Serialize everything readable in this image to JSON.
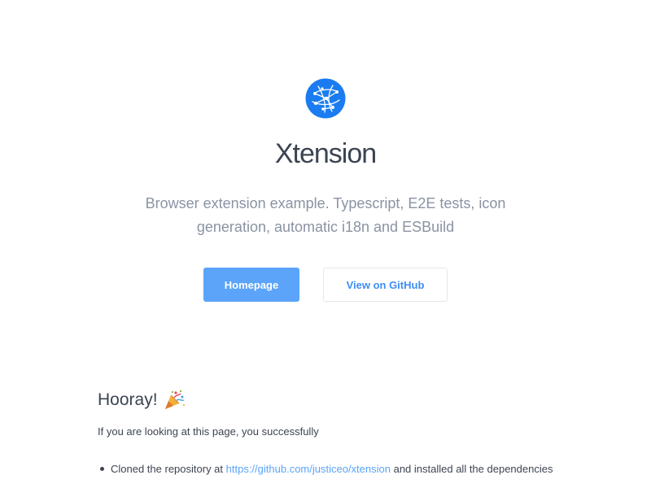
{
  "hero": {
    "logo_icon": "globe-network-icon",
    "title": "Xtension",
    "subtitle": "Browser extension example. Typescript, E2E tests, icon generation, automatic i18n and ESBuild"
  },
  "buttons": {
    "primary_label": "Homepage",
    "secondary_label": "View on GitHub"
  },
  "content": {
    "heading": "Hooray!",
    "heading_icon": "party-popper-icon",
    "intro": "If you are looking at this page, you successfully",
    "items": [
      {
        "prefix": "Cloned the repository at ",
        "link": "https://github.com/justiceo/xtension",
        "suffix": " and installed all the dependencies"
      }
    ]
  },
  "colors": {
    "accent": "#5ba4f9",
    "title": "#3b4452",
    "muted": "#8a93a3"
  }
}
